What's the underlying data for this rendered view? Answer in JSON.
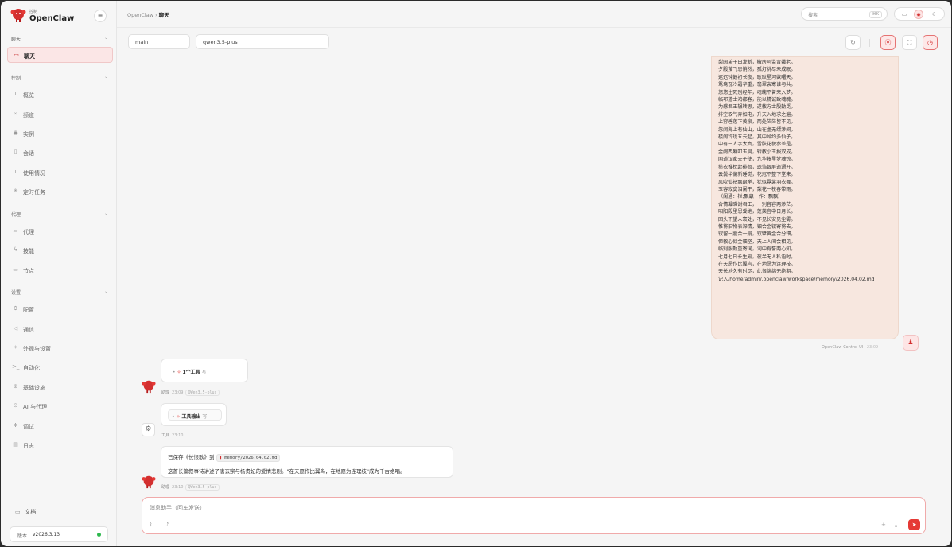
{
  "sidebar": {
    "brand_sub": "控制",
    "brand_name": "OpenClaw",
    "sections": {
      "chat": "聊天",
      "control": "控制",
      "agent": "代理",
      "settings": "设置"
    },
    "items": {
      "chat": "聊天",
      "overview": "概览",
      "channels": "频道",
      "instances": "实例",
      "sessions": "会话",
      "usage": "使用情况",
      "cron": "定时任务",
      "agents": "代理",
      "skills": "技能",
      "nodes": "节点",
      "config": "配置",
      "comms": "通信",
      "appearance": "外观与设置",
      "automation": "自动化",
      "infra": "基础设施",
      "ai_agents": "AI 与代理",
      "debug": "调试",
      "logs": "日志"
    },
    "docs": "文档",
    "version_label": "版本",
    "version": "v2026.3.13"
  },
  "topbar": {
    "crumb_root": "OpenClaw",
    "crumb_sep": "›",
    "crumb_current": "聊天",
    "search_placeholder": "搜索",
    "search_shortcut": "⌘K"
  },
  "controls": {
    "session": "main",
    "model": "qwen3.5-plus"
  },
  "user_message": {
    "lines": [
      "梨园弟子白发新，椒房阿监青娥老。",
      "夕殿萤飞思悄然，孤灯挑尽未成眠。",
      "迟迟钟鼓初长夜，耿耿星河欲曙天。",
      "鸳鸯瓦冷霜华重，翡翠衾寒谁与共。",
      "悠悠生死别经年，魂魄不曾来入梦。",
      "临邛道士鸿都客，能以精诚致魂魄。",
      "为感君王辗转思，遂教方士殷勤觅。",
      "排空驭气奔如电，升天入地求之遍。",
      "上穷碧落下黄泉，两处茫茫皆不见。",
      "忽闻海上有仙山，山在虚无缥渺间。",
      "楼阁玲珑五云起，其中绰约多仙子。",
      "中有一人字太真，雪肤花貌参差是。",
      "金阙西厢叩玉扃，转教小玉报双成。",
      "闻道汉家天子使，九华帐里梦魂惊。",
      "揽衣推枕起徘徊，珠箔银屏迤逦开。",
      "云鬓半偏新睡觉，花冠不整下堂来。",
      "风吹仙袂飘飖举，犹似霓裳羽衣舞。",
      "玉容寂寞泪阑干，梨花一枝春带雨。",
      "（阑通：栏;飘飖一作：飘飘）",
      "含情凝睇谢君王，一别音容两渺茫。",
      "昭阳殿里恩爱绝，蓬莱宫中日月长。",
      "回头下望人寰处，不见长安见尘雾。",
      "惟将旧物表深情，钿合金钗寄将去。",
      "钗留一股合一扇，钗擘黄金合分钿。",
      "但教心似金钿坚，天上人间会相见。",
      "临别殷勤重寄词，词中有誓两心知。",
      "七月七日长生殿，夜半无人私语时。",
      "在天愿作比翼鸟，在地愿为连理枝。",
      "天长地久有时尽，此恨绵绵无绝期。",
      "记入/home/admin/.openclaw/workspace/memory/2026.04.02.md"
    ],
    "sender": "OpenClaw-Control-UI",
    "time": "23:09"
  },
  "messages": {
    "tool_call_label": "1个工具",
    "tool_call_extra": "写",
    "assistant1_sender": "助理",
    "assistant1_time": "23:09",
    "assistant1_model": "QWen3.5-plus",
    "tool_output_label": "工具输出",
    "tool_output_extra": "写",
    "tool_sender": "工具",
    "tool_time": "23:10",
    "final_prefix": "已保存《长恨歌》到",
    "final_path": "memory/2026.04.02.md",
    "final_line2": "这首长篇叙事诗讲述了唐玄宗与杨贵妃的爱情悲剧。\"在天愿作比翼鸟，在地愿为连理枝\"成为千古绝唱。",
    "assistant2_sender": "助理",
    "assistant2_time": "23:10",
    "assistant2_model": "QWen3.5-plus"
  },
  "composer": {
    "placeholder": "消息助手（回车发送）"
  },
  "colors": {
    "accent": "#e53935",
    "user_bubble": "#f7e7df",
    "status_online": "#2db84d"
  }
}
